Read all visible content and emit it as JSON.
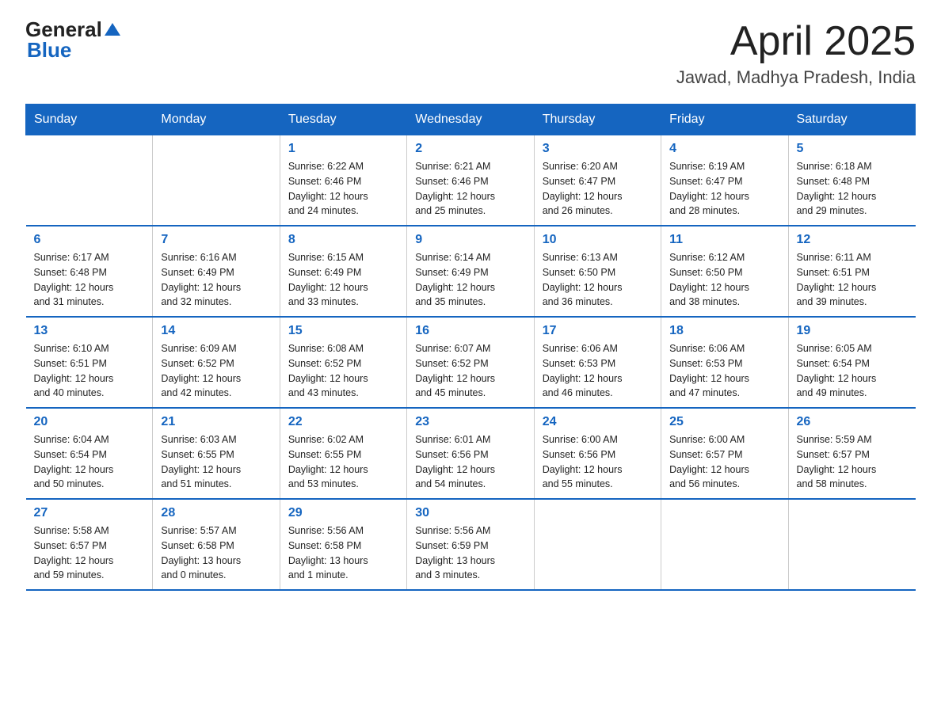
{
  "header": {
    "logo": {
      "text_general": "General",
      "text_blue": "Blue"
    },
    "title": "April 2025",
    "location": "Jawad, Madhya Pradesh, India"
  },
  "weekdays": [
    "Sunday",
    "Monday",
    "Tuesday",
    "Wednesday",
    "Thursday",
    "Friday",
    "Saturday"
  ],
  "weeks": [
    [
      {
        "day": "",
        "info": ""
      },
      {
        "day": "",
        "info": ""
      },
      {
        "day": "1",
        "info": "Sunrise: 6:22 AM\nSunset: 6:46 PM\nDaylight: 12 hours\nand 24 minutes."
      },
      {
        "day": "2",
        "info": "Sunrise: 6:21 AM\nSunset: 6:46 PM\nDaylight: 12 hours\nand 25 minutes."
      },
      {
        "day": "3",
        "info": "Sunrise: 6:20 AM\nSunset: 6:47 PM\nDaylight: 12 hours\nand 26 minutes."
      },
      {
        "day": "4",
        "info": "Sunrise: 6:19 AM\nSunset: 6:47 PM\nDaylight: 12 hours\nand 28 minutes."
      },
      {
        "day": "5",
        "info": "Sunrise: 6:18 AM\nSunset: 6:48 PM\nDaylight: 12 hours\nand 29 minutes."
      }
    ],
    [
      {
        "day": "6",
        "info": "Sunrise: 6:17 AM\nSunset: 6:48 PM\nDaylight: 12 hours\nand 31 minutes."
      },
      {
        "day": "7",
        "info": "Sunrise: 6:16 AM\nSunset: 6:49 PM\nDaylight: 12 hours\nand 32 minutes."
      },
      {
        "day": "8",
        "info": "Sunrise: 6:15 AM\nSunset: 6:49 PM\nDaylight: 12 hours\nand 33 minutes."
      },
      {
        "day": "9",
        "info": "Sunrise: 6:14 AM\nSunset: 6:49 PM\nDaylight: 12 hours\nand 35 minutes."
      },
      {
        "day": "10",
        "info": "Sunrise: 6:13 AM\nSunset: 6:50 PM\nDaylight: 12 hours\nand 36 minutes."
      },
      {
        "day": "11",
        "info": "Sunrise: 6:12 AM\nSunset: 6:50 PM\nDaylight: 12 hours\nand 38 minutes."
      },
      {
        "day": "12",
        "info": "Sunrise: 6:11 AM\nSunset: 6:51 PM\nDaylight: 12 hours\nand 39 minutes."
      }
    ],
    [
      {
        "day": "13",
        "info": "Sunrise: 6:10 AM\nSunset: 6:51 PM\nDaylight: 12 hours\nand 40 minutes."
      },
      {
        "day": "14",
        "info": "Sunrise: 6:09 AM\nSunset: 6:52 PM\nDaylight: 12 hours\nand 42 minutes."
      },
      {
        "day": "15",
        "info": "Sunrise: 6:08 AM\nSunset: 6:52 PM\nDaylight: 12 hours\nand 43 minutes."
      },
      {
        "day": "16",
        "info": "Sunrise: 6:07 AM\nSunset: 6:52 PM\nDaylight: 12 hours\nand 45 minutes."
      },
      {
        "day": "17",
        "info": "Sunrise: 6:06 AM\nSunset: 6:53 PM\nDaylight: 12 hours\nand 46 minutes."
      },
      {
        "day": "18",
        "info": "Sunrise: 6:06 AM\nSunset: 6:53 PM\nDaylight: 12 hours\nand 47 minutes."
      },
      {
        "day": "19",
        "info": "Sunrise: 6:05 AM\nSunset: 6:54 PM\nDaylight: 12 hours\nand 49 minutes."
      }
    ],
    [
      {
        "day": "20",
        "info": "Sunrise: 6:04 AM\nSunset: 6:54 PM\nDaylight: 12 hours\nand 50 minutes."
      },
      {
        "day": "21",
        "info": "Sunrise: 6:03 AM\nSunset: 6:55 PM\nDaylight: 12 hours\nand 51 minutes."
      },
      {
        "day": "22",
        "info": "Sunrise: 6:02 AM\nSunset: 6:55 PM\nDaylight: 12 hours\nand 53 minutes."
      },
      {
        "day": "23",
        "info": "Sunrise: 6:01 AM\nSunset: 6:56 PM\nDaylight: 12 hours\nand 54 minutes."
      },
      {
        "day": "24",
        "info": "Sunrise: 6:00 AM\nSunset: 6:56 PM\nDaylight: 12 hours\nand 55 minutes."
      },
      {
        "day": "25",
        "info": "Sunrise: 6:00 AM\nSunset: 6:57 PM\nDaylight: 12 hours\nand 56 minutes."
      },
      {
        "day": "26",
        "info": "Sunrise: 5:59 AM\nSunset: 6:57 PM\nDaylight: 12 hours\nand 58 minutes."
      }
    ],
    [
      {
        "day": "27",
        "info": "Sunrise: 5:58 AM\nSunset: 6:57 PM\nDaylight: 12 hours\nand 59 minutes."
      },
      {
        "day": "28",
        "info": "Sunrise: 5:57 AM\nSunset: 6:58 PM\nDaylight: 13 hours\nand 0 minutes."
      },
      {
        "day": "29",
        "info": "Sunrise: 5:56 AM\nSunset: 6:58 PM\nDaylight: 13 hours\nand 1 minute."
      },
      {
        "day": "30",
        "info": "Sunrise: 5:56 AM\nSunset: 6:59 PM\nDaylight: 13 hours\nand 3 minutes."
      },
      {
        "day": "",
        "info": ""
      },
      {
        "day": "",
        "info": ""
      },
      {
        "day": "",
        "info": ""
      }
    ]
  ]
}
